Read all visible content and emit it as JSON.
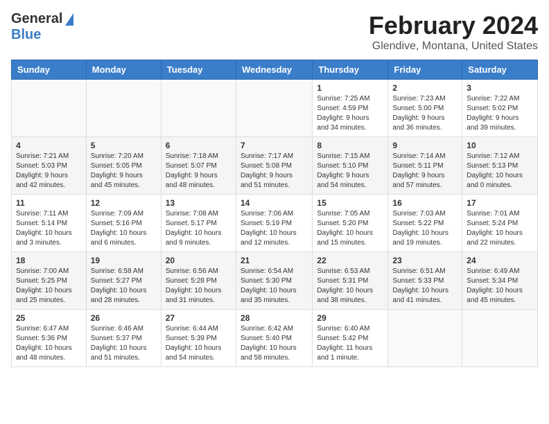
{
  "logo": {
    "general": "General",
    "blue": "Blue"
  },
  "title": "February 2024",
  "subtitle": "Glendive, Montana, United States",
  "days_of_week": [
    "Sunday",
    "Monday",
    "Tuesday",
    "Wednesday",
    "Thursday",
    "Friday",
    "Saturday"
  ],
  "weeks": [
    [
      {
        "day": "",
        "info": ""
      },
      {
        "day": "",
        "info": ""
      },
      {
        "day": "",
        "info": ""
      },
      {
        "day": "",
        "info": ""
      },
      {
        "day": "1",
        "info": "Sunrise: 7:25 AM\nSunset: 4:59 PM\nDaylight: 9 hours\nand 34 minutes."
      },
      {
        "day": "2",
        "info": "Sunrise: 7:23 AM\nSunset: 5:00 PM\nDaylight: 9 hours\nand 36 minutes."
      },
      {
        "day": "3",
        "info": "Sunrise: 7:22 AM\nSunset: 5:02 PM\nDaylight: 9 hours\nand 39 minutes."
      }
    ],
    [
      {
        "day": "4",
        "info": "Sunrise: 7:21 AM\nSunset: 5:03 PM\nDaylight: 9 hours\nand 42 minutes."
      },
      {
        "day": "5",
        "info": "Sunrise: 7:20 AM\nSunset: 5:05 PM\nDaylight: 9 hours\nand 45 minutes."
      },
      {
        "day": "6",
        "info": "Sunrise: 7:18 AM\nSunset: 5:07 PM\nDaylight: 9 hours\nand 48 minutes."
      },
      {
        "day": "7",
        "info": "Sunrise: 7:17 AM\nSunset: 5:08 PM\nDaylight: 9 hours\nand 51 minutes."
      },
      {
        "day": "8",
        "info": "Sunrise: 7:15 AM\nSunset: 5:10 PM\nDaylight: 9 hours\nand 54 minutes."
      },
      {
        "day": "9",
        "info": "Sunrise: 7:14 AM\nSunset: 5:11 PM\nDaylight: 9 hours\nand 57 minutes."
      },
      {
        "day": "10",
        "info": "Sunrise: 7:12 AM\nSunset: 5:13 PM\nDaylight: 10 hours\nand 0 minutes."
      }
    ],
    [
      {
        "day": "11",
        "info": "Sunrise: 7:11 AM\nSunset: 5:14 PM\nDaylight: 10 hours\nand 3 minutes."
      },
      {
        "day": "12",
        "info": "Sunrise: 7:09 AM\nSunset: 5:16 PM\nDaylight: 10 hours\nand 6 minutes."
      },
      {
        "day": "13",
        "info": "Sunrise: 7:08 AM\nSunset: 5:17 PM\nDaylight: 10 hours\nand 9 minutes."
      },
      {
        "day": "14",
        "info": "Sunrise: 7:06 AM\nSunset: 5:19 PM\nDaylight: 10 hours\nand 12 minutes."
      },
      {
        "day": "15",
        "info": "Sunrise: 7:05 AM\nSunset: 5:20 PM\nDaylight: 10 hours\nand 15 minutes."
      },
      {
        "day": "16",
        "info": "Sunrise: 7:03 AM\nSunset: 5:22 PM\nDaylight: 10 hours\nand 19 minutes."
      },
      {
        "day": "17",
        "info": "Sunrise: 7:01 AM\nSunset: 5:24 PM\nDaylight: 10 hours\nand 22 minutes."
      }
    ],
    [
      {
        "day": "18",
        "info": "Sunrise: 7:00 AM\nSunset: 5:25 PM\nDaylight: 10 hours\nand 25 minutes."
      },
      {
        "day": "19",
        "info": "Sunrise: 6:58 AM\nSunset: 5:27 PM\nDaylight: 10 hours\nand 28 minutes."
      },
      {
        "day": "20",
        "info": "Sunrise: 6:56 AM\nSunset: 5:28 PM\nDaylight: 10 hours\nand 31 minutes."
      },
      {
        "day": "21",
        "info": "Sunrise: 6:54 AM\nSunset: 5:30 PM\nDaylight: 10 hours\nand 35 minutes."
      },
      {
        "day": "22",
        "info": "Sunrise: 6:53 AM\nSunset: 5:31 PM\nDaylight: 10 hours\nand 38 minutes."
      },
      {
        "day": "23",
        "info": "Sunrise: 6:51 AM\nSunset: 5:33 PM\nDaylight: 10 hours\nand 41 minutes."
      },
      {
        "day": "24",
        "info": "Sunrise: 6:49 AM\nSunset: 5:34 PM\nDaylight: 10 hours\nand 45 minutes."
      }
    ],
    [
      {
        "day": "25",
        "info": "Sunrise: 6:47 AM\nSunset: 5:36 PM\nDaylight: 10 hours\nand 48 minutes."
      },
      {
        "day": "26",
        "info": "Sunrise: 6:46 AM\nSunset: 5:37 PM\nDaylight: 10 hours\nand 51 minutes."
      },
      {
        "day": "27",
        "info": "Sunrise: 6:44 AM\nSunset: 5:39 PM\nDaylight: 10 hours\nand 54 minutes."
      },
      {
        "day": "28",
        "info": "Sunrise: 6:42 AM\nSunset: 5:40 PM\nDaylight: 10 hours\nand 58 minutes."
      },
      {
        "day": "29",
        "info": "Sunrise: 6:40 AM\nSunset: 5:42 PM\nDaylight: 11 hours\nand 1 minute."
      },
      {
        "day": "",
        "info": ""
      },
      {
        "day": "",
        "info": ""
      }
    ]
  ]
}
